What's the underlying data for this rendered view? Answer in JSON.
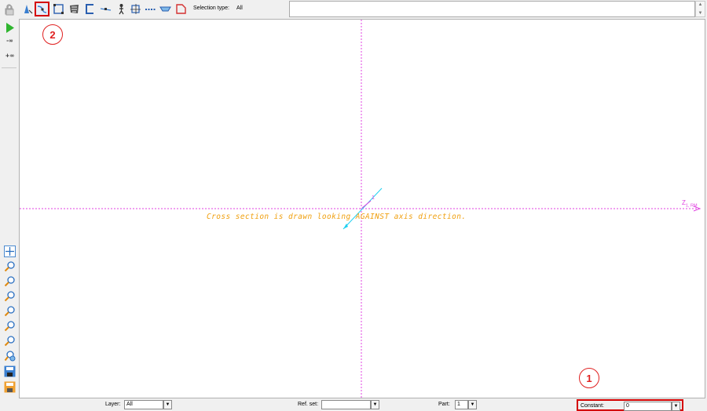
{
  "toolbar": {
    "selection_type_label": "Selection type:",
    "selection_type_value": "All",
    "buttons": [
      {
        "icon": "snap-mode-icon"
      },
      {
        "icon": "select-curve-icon",
        "active": true
      },
      {
        "icon": "select-rectangle-icon"
      },
      {
        "icon": "select-region-icon"
      },
      {
        "icon": "select-section-icon"
      },
      {
        "icon": "select-line-icon"
      },
      {
        "icon": "select-figure-icon"
      },
      {
        "icon": "select-frame-icon"
      },
      {
        "icon": "select-dashed-icon"
      },
      {
        "icon": "select-face-icon"
      },
      {
        "icon": "select-corner-icon"
      }
    ]
  },
  "left_toolbar": {
    "minus_infinity_label": "-∞",
    "plus_infinity_label": "+∞",
    "buttons": [
      "lock-icon",
      "play-icon",
      "pan-icon",
      "zoom-icon",
      "zoom-icon",
      "zoom-icon",
      "zoom-icon",
      "zoom-icon",
      "zoom-icon",
      "zoom-icon",
      "zoom-settings-icon",
      "save-view-icon",
      "load-view-icon"
    ]
  },
  "canvas": {
    "note": "Cross section is drawn looking AGAINST axis direction.",
    "axis_label_main": "Z",
    "axis_label_sub": "1, RM",
    "origin_label": "1",
    "colors": {
      "axis": "#e040e0",
      "note": "#f0a010",
      "vector": "#20d0f0"
    }
  },
  "callouts": {
    "one": "1",
    "two": "2"
  },
  "statusbar": {
    "layer_label": "Layer:",
    "layer_value": "All",
    "ref_set_label": "Ref. set:",
    "ref_set_value": "",
    "part_label": "Part:",
    "part_value": "1",
    "constant_label": "Constant:",
    "constant_value": "0",
    "highlight_color": "#d40000"
  }
}
